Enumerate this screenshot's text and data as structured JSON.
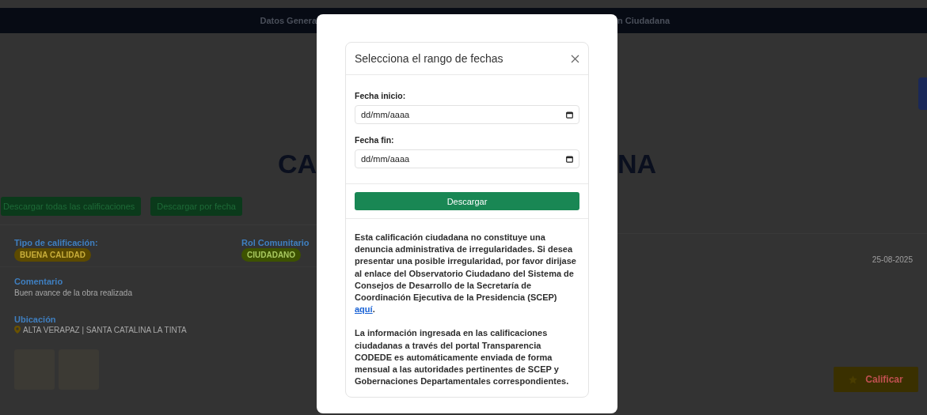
{
  "nav": {
    "items": [
      "Datos Genera",
      "n Ciudadana"
    ]
  },
  "page": {
    "title_left": "CA",
    "title_right": "NA",
    "download_buttons": [
      "Descargar todas las calificaciones",
      "Descargar por fecha"
    ],
    "rating": {
      "type_label": "Tipo de calificación:",
      "type_badge": "BUENA CALIDAD",
      "role_label": "Rol Comunitario",
      "role_badge": "CIUDADANO",
      "date": "25-08-2025",
      "comment_label": "Comentario",
      "comment": "Buen avance de la obra realizada",
      "location_label": "Ubicación",
      "location": "ALTA VERAPAZ | SANTA CATALINA LA TINTA"
    },
    "rate_button": "Calificar"
  },
  "modal": {
    "title": "Selecciona el rango de fechas",
    "fields": [
      {
        "label": "Fecha inicio:",
        "placeholder": "dd/mm/aaaa"
      },
      {
        "label": "Fecha fin:",
        "placeholder": "dd/mm/aaaa"
      }
    ],
    "submit": "Descargar",
    "notice": {
      "text": "Esta calificación ciudadana no constituye una denuncia administrativa de irregularidades. Si desea presentar una posible irregularidad, por favor dirijase al enlace del Observatorio Ciudadano del Sistema de Consejos de Desarrollo de la Secretaría de Coordinación Ejecutiva de la Presidencia (SCEP)",
      "link": "aquí",
      "after": "."
    },
    "info": "La información ingresada en las calificaciones ciudadanas a través del portal Transparencia CODEDE es automáticamente enviada de forma mensual a las autoridades pertinentes de SCEP y Gobernaciones Departamentales correspondientes."
  }
}
